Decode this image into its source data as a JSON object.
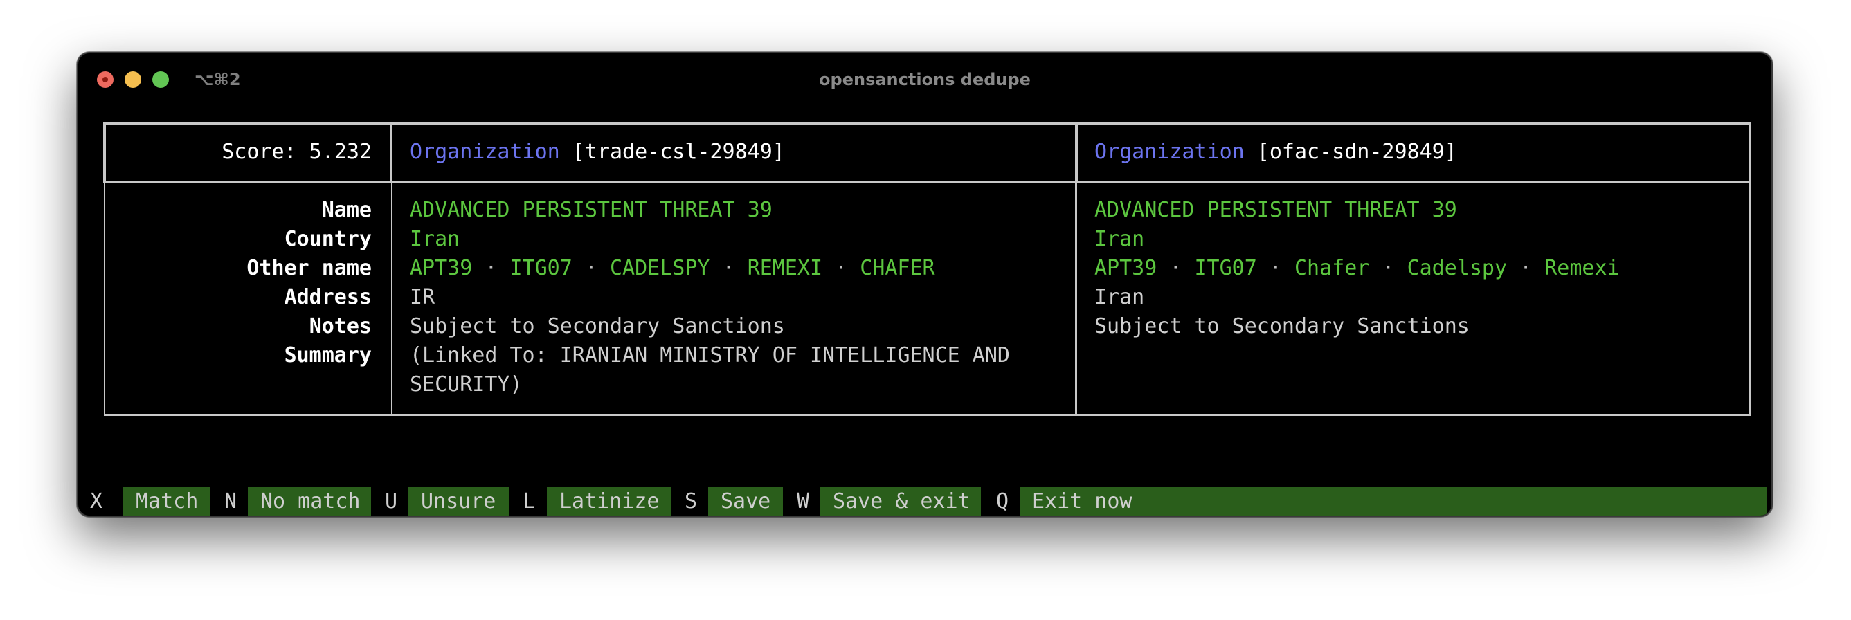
{
  "window": {
    "title": "opensanctions dedupe",
    "shortcut": "⌥⌘2"
  },
  "header": {
    "score_label": "Score: 5.232",
    "left": {
      "schema": "Organization",
      "id": "[trade-csl-29849]"
    },
    "right": {
      "schema": "Organization",
      "id": "[ofac-sdn-29849]"
    }
  },
  "labels": [
    "Name",
    "Country",
    "Other name",
    "Address",
    "Notes",
    "Summary"
  ],
  "left": {
    "name": "ADVANCED PERSISTENT THREAT 39",
    "country": "Iran",
    "other_names": [
      "APT39",
      "ITG07",
      "CADELSPY",
      "REMEXI",
      "CHAFER"
    ],
    "address": "IR",
    "notes": "Subject to Secondary Sanctions",
    "summary_line1": "(Linked To: IRANIAN MINISTRY OF INTELLIGENCE AND",
    "summary_line2": "SECURITY)"
  },
  "right": {
    "name": "ADVANCED PERSISTENT THREAT 39",
    "country": "Iran",
    "other_names": [
      "APT39",
      "ITG07",
      "Chafer",
      "Cadelspy",
      "Remexi"
    ],
    "address": "Iran",
    "notes": "Subject to Secondary Sanctions"
  },
  "separator": "·",
  "footer": [
    {
      "key": "X",
      "label": "Match"
    },
    {
      "key": "N",
      "label": "No match"
    },
    {
      "key": "U",
      "label": "Unsure"
    },
    {
      "key": "L",
      "label": "Latinize"
    },
    {
      "key": "S",
      "label": "Save"
    },
    {
      "key": "W",
      "label": "Save & exit"
    },
    {
      "key": "Q",
      "label": "Exit now"
    }
  ],
  "colors": {
    "match": "#5cc63f",
    "schema": "#6c74ef",
    "footer_bg": "#2a5e1b"
  }
}
